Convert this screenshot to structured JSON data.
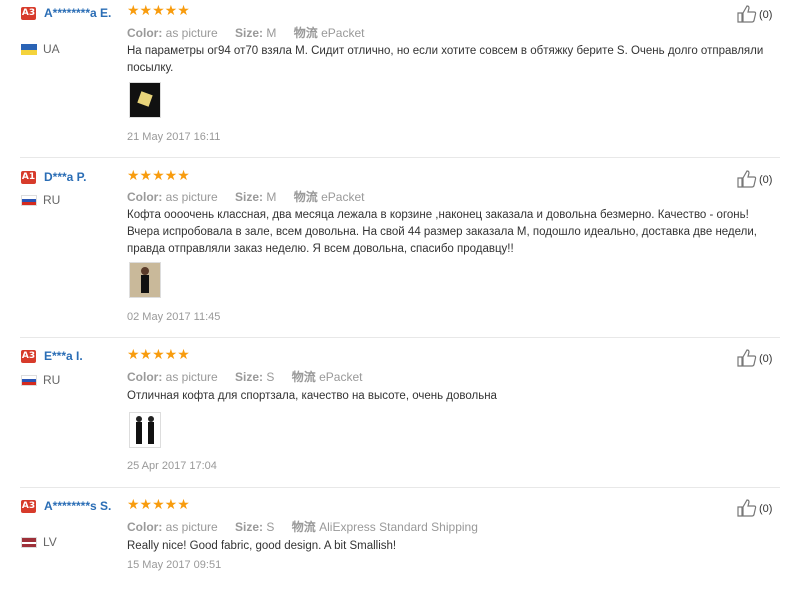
{
  "labels": {
    "color": "Color:",
    "size": "Size:",
    "shipping": "物流"
  },
  "reviews": [
    {
      "badge": "A3",
      "name": "A********a E.",
      "country": "UA",
      "stars": "★★★★★",
      "color": "as picture",
      "size": "M",
      "shipping": "ePacket",
      "text": "На параметры ог94 от70 взяла М. Сидит отлично, но если хотите совсем в обтяжку берите S. Очень долго отправляли посылку.",
      "date": "21 May 2017 16:11",
      "likes": "(0)",
      "flag_colors": [
        "#2a63b5",
        "#f4d33c"
      ]
    },
    {
      "badge": "A1",
      "name": "D***a P.",
      "country": "RU",
      "stars": "★★★★★",
      "color": "as picture",
      "size": "M",
      "shipping": "ePacket",
      "text": "Кофта оооочень классная, два месяца лежала в корзине ,наконец заказала и довольна безмерно. Качество - огонь! Вчера испробовала в зале, всем довольна. На свой 44 размер заказала М, подошло идеально, доставка две недели, правда отправляли заказ неделю. Я всем довольна, спасибо продавцу!!",
      "date": "02 May 2017 11:45",
      "likes": "(0)",
      "flag_colors": [
        "#ffffff",
        "#2a55b5",
        "#d52b1e"
      ]
    },
    {
      "badge": "A3",
      "name": "E***a I.",
      "country": "RU",
      "stars": "★★★★★",
      "color": "as picture",
      "size": "S",
      "shipping": "ePacket",
      "text": "Отличная кофта для спортзала, качество на высоте, очень довольна",
      "date": "25 Apr 2017 17:04",
      "likes": "(0)",
      "flag_colors": [
        "#ffffff",
        "#2a55b5",
        "#d52b1e"
      ]
    },
    {
      "badge": "A3",
      "name": "A********s S.",
      "country": "LV",
      "stars": "★★★★★",
      "color": "as picture",
      "size": "S",
      "shipping": "AliExpress Standard Shipping",
      "text": "Really nice! Good fabric, good design. A bit Smallish!",
      "date": "15 May 2017 09:51",
      "likes": "(0)",
      "flag_colors": [
        "#9e3039",
        "#ffffff",
        "#9e3039"
      ]
    }
  ]
}
